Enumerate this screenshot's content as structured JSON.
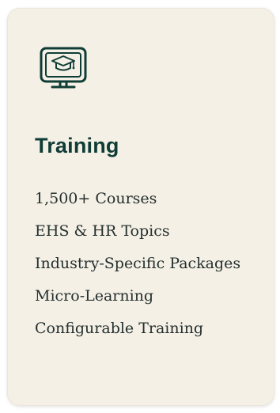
{
  "card": {
    "icon": "online-training-monitor-icon",
    "title": "Training",
    "features": [
      "1,500+ Courses",
      "EHS & HR Topics",
      "Industry-Specific Packages",
      "Micro-Learning",
      "Configurable Training"
    ]
  },
  "colors": {
    "card_bg": "#f5f0e6",
    "title": "#0f3d36",
    "text": "#24302e",
    "icon_stroke": "#0f3d36"
  }
}
